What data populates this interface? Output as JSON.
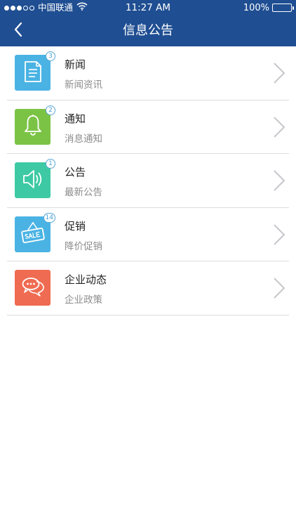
{
  "status_bar": {
    "carrier": "中国联通",
    "time": "11:27 AM",
    "battery": "100%"
  },
  "nav": {
    "title": "信息公告",
    "back_icon": "chevron-left-icon"
  },
  "colors": {
    "nav_bg": "#1f4e92",
    "news": "#4ab3e4",
    "notice": "#7bc345",
    "announcement": "#3dc9a4",
    "promotion": "#4ab3e4",
    "dynamics": "#ef6b51"
  },
  "items": [
    {
      "title": "新闻",
      "subtitle": "新闻资讯",
      "badge": "3",
      "icon": "document-icon"
    },
    {
      "title": "通知",
      "subtitle": "消息通知",
      "badge": "2",
      "icon": "bell-icon"
    },
    {
      "title": "公告",
      "subtitle": "最新公告",
      "badge": "1",
      "icon": "speaker-icon"
    },
    {
      "title": "促销",
      "subtitle": "降价促销",
      "badge": "14",
      "icon": "sale-sign-icon"
    },
    {
      "title": "企业动态",
      "subtitle": "企业政策",
      "icon": "chat-bubbles-icon"
    }
  ]
}
